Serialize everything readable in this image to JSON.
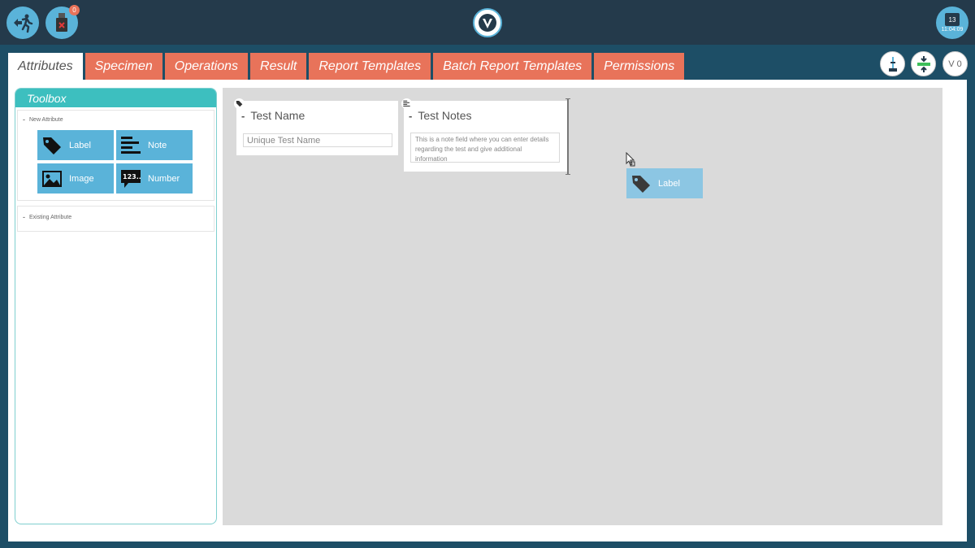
{
  "header": {
    "usb_badge_count": "0",
    "calendar_day": "13",
    "clock_time": "11:04:09"
  },
  "tabs": [
    {
      "label": "Attributes",
      "active": true
    },
    {
      "label": "Specimen"
    },
    {
      "label": "Operations"
    },
    {
      "label": "Result"
    },
    {
      "label": "Report Templates"
    },
    {
      "label": "Batch Report Templates"
    },
    {
      "label": "Permissions"
    }
  ],
  "toolbar": {
    "version_label": "V 0"
  },
  "toolbox": {
    "title": "Toolbox",
    "new_attribute": {
      "title": "New Attribute",
      "items": [
        {
          "label": "Label",
          "icon": "tag-icon"
        },
        {
          "label": "Note",
          "icon": "note-lines-icon"
        },
        {
          "label": "Image",
          "icon": "image-icon"
        },
        {
          "label": "Number",
          "icon": "number-icon"
        }
      ]
    },
    "existing_attribute": {
      "title": "Existing Attribute"
    }
  },
  "canvas": {
    "cards": [
      {
        "title": "Test Name",
        "type_icon": "tag-icon",
        "value": "Unique Test Name"
      },
      {
        "title": "Test Notes",
        "type_icon": "note-lines-icon",
        "value": "This is a note field where you can enter details regarding the test and give additional information"
      }
    ],
    "dragging_item": {
      "label": "Label",
      "icon": "tag-icon"
    }
  },
  "colors": {
    "topbar": "#243a4b",
    "accent_blue": "#5ab3d9",
    "tab_orange": "#e8735a",
    "toolbox_teal": "#3dbfbf",
    "canvas_gray": "#dadada"
  }
}
